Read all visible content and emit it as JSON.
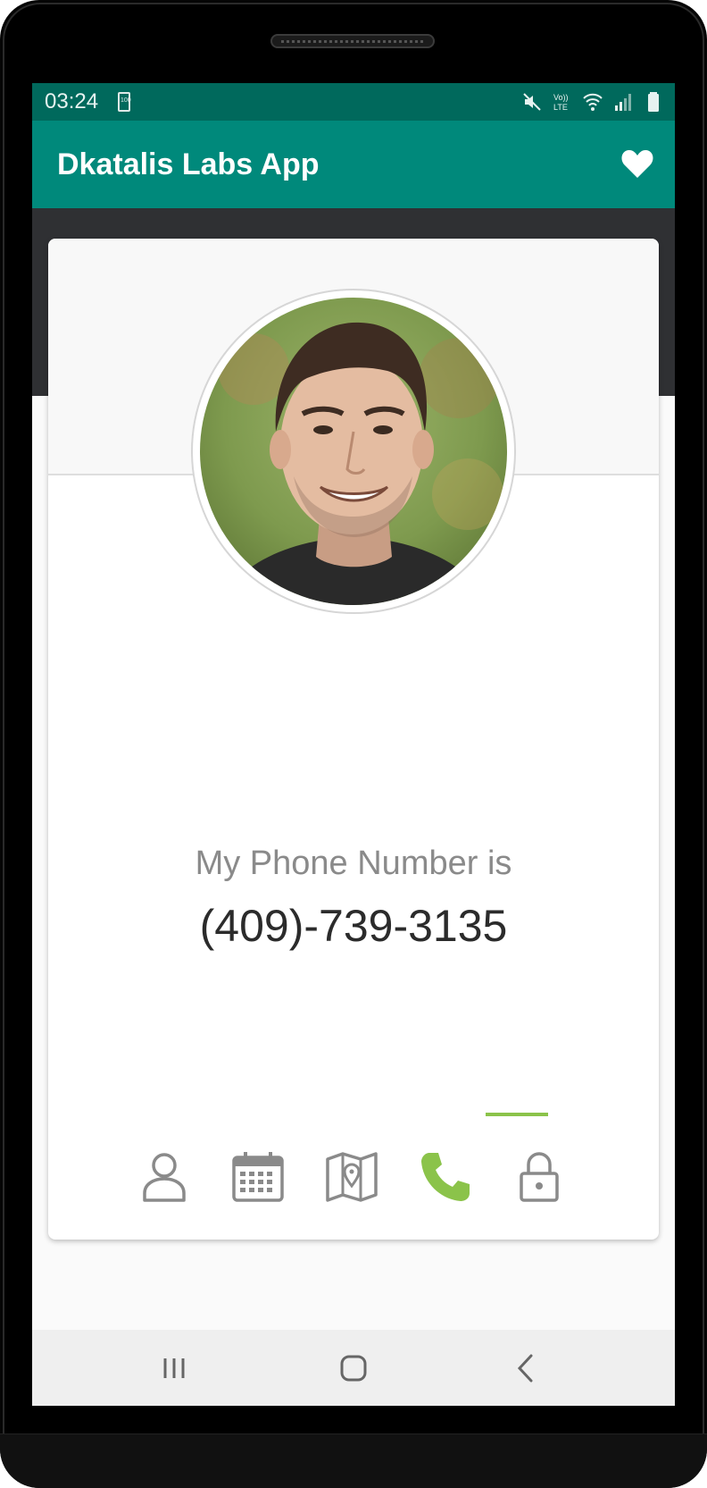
{
  "status_bar": {
    "time": "03:24",
    "battery_label": "100",
    "volte_label": "VoLTE"
  },
  "app_bar": {
    "title": "Dkatalis Labs App",
    "favorite_icon": "heart-icon"
  },
  "profile": {
    "label": "My Phone Number is",
    "value": "(409)-739-3135"
  },
  "tabs": [
    {
      "icon": "person-icon",
      "active": false
    },
    {
      "icon": "calendar-icon",
      "active": false
    },
    {
      "icon": "map-icon",
      "active": false
    },
    {
      "icon": "phone-icon",
      "active": true
    },
    {
      "icon": "lock-icon",
      "active": false
    }
  ],
  "colors": {
    "status_bar": "#00695c",
    "app_bar": "#00897b",
    "active_tab": "#8bc34a",
    "inactive_tab": "#8a8a8a"
  },
  "navigation": [
    "recent-apps-icon",
    "home-icon",
    "back-icon"
  ]
}
